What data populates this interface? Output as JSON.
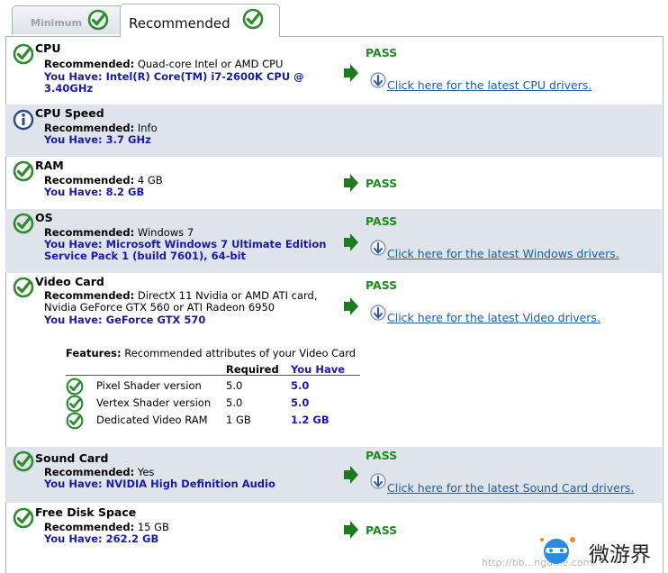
{
  "tabs": {
    "minimum": "Minimum",
    "recommended": "Recommended"
  },
  "colors": {
    "pass": "#1f8a1f",
    "have": "#1a1aaa",
    "link": "#1a5faa",
    "alt_row": "#dfe3ea"
  },
  "labels": {
    "recommended": "Recommended:",
    "pass": "PASS"
  },
  "rows": [
    {
      "title": "CPU",
      "recommended": "Quad-core Intel or AMD CPU",
      "have_lines": [
        "You Have: Intel(R) Core(TM) i7-2600K CPU @",
        "3.40GHz"
      ],
      "status": "check-icon",
      "result": "PASS",
      "link": "Click here for the latest CPU drivers."
    },
    {
      "title": "CPU Speed",
      "recommended": "Info",
      "have_lines": [
        "You Have: 3.7 GHz"
      ],
      "status": "info-icon"
    },
    {
      "title": "RAM",
      "recommended": "4 GB",
      "have_lines": [
        "You Have: 8.2 GB"
      ],
      "status": "check-icon",
      "result": "PASS"
    },
    {
      "title": "OS",
      "recommended": "Windows 7",
      "have_lines": [
        "You Have: Microsoft Windows 7 Ultimate Edition",
        "Service Pack 1 (build 7601), 64-bit"
      ],
      "status": "check-icon",
      "result": "PASS",
      "link": "Click here for the latest Windows drivers."
    },
    {
      "title": "Video Card",
      "recommended_lines": [
        "DirectX 11 Nvidia or AMD ATI card,",
        "Nvidia GeForce GTX 560 or ATI Radeon 6950"
      ],
      "have_lines": [
        "You Have: GeForce GTX 570"
      ],
      "status": "check-icon",
      "result": "PASS",
      "link": "Click here for the latest Video drivers."
    },
    {
      "title": "Sound Card",
      "recommended": "Yes",
      "have_lines": [
        "You Have: NVIDIA High Definition Audio"
      ],
      "status": "check-icon",
      "result": "PASS",
      "link": "Click here for the latest Sound Card drivers."
    },
    {
      "title": "Free Disk Space",
      "recommended": "15 GB",
      "have_lines": [
        "You Have: 262.2 GB"
      ],
      "status": "check-icon",
      "result": "PASS"
    }
  ],
  "features": {
    "label": "Features:",
    "description": "Recommended attributes of your Video Card",
    "col_required": "Required",
    "col_you_have": "You Have",
    "items": [
      {
        "name": "Pixel Shader version",
        "required": "5.0",
        "have": "5.0"
      },
      {
        "name": "Vertex Shader version",
        "required": "5.0",
        "have": "5.0"
      },
      {
        "name": "Dedicated Video RAM",
        "required": "1 GB",
        "have": "1.2 GB"
      }
    ]
  },
  "watermark": {
    "brand": "微游界",
    "url": "http://bb...ngame.com/"
  }
}
